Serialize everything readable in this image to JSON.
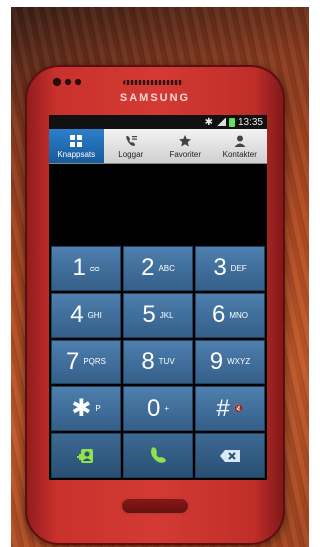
{
  "phone": {
    "brand": "SAMSUNG",
    "status_time": "13:35"
  },
  "tabs": [
    {
      "label": "Knappsats",
      "icon": "keypad-icon",
      "active": true
    },
    {
      "label": "Loggar",
      "icon": "call-log-icon",
      "active": false
    },
    {
      "label": "Favoriter",
      "icon": "star-icon",
      "active": false
    },
    {
      "label": "Kontakter",
      "icon": "contact-icon",
      "active": false
    }
  ],
  "keys": [
    {
      "digit": "1",
      "letters": "ᴑᴑ"
    },
    {
      "digit": "2",
      "letters": "ABC"
    },
    {
      "digit": "3",
      "letters": "DEF"
    },
    {
      "digit": "4",
      "letters": "GHI"
    },
    {
      "digit": "5",
      "letters": "JKL"
    },
    {
      "digit": "6",
      "letters": "MNO"
    },
    {
      "digit": "7",
      "letters": "PQRS"
    },
    {
      "digit": "8",
      "letters": "TUV"
    },
    {
      "digit": "9",
      "letters": "WXYZ"
    },
    {
      "digit": "✱",
      "letters": "P"
    },
    {
      "digit": "0",
      "letters": "+"
    },
    {
      "digit": "#",
      "letters": "🔇"
    }
  ],
  "actions": [
    {
      "name": "add-contact-icon"
    },
    {
      "name": "call-icon"
    },
    {
      "name": "backspace-icon"
    }
  ],
  "colors": {
    "phone_body": "#d43a33",
    "key_blue": "#4e7fae",
    "active_tab": "#2d7fc9",
    "call_green": "#8fe24a"
  }
}
